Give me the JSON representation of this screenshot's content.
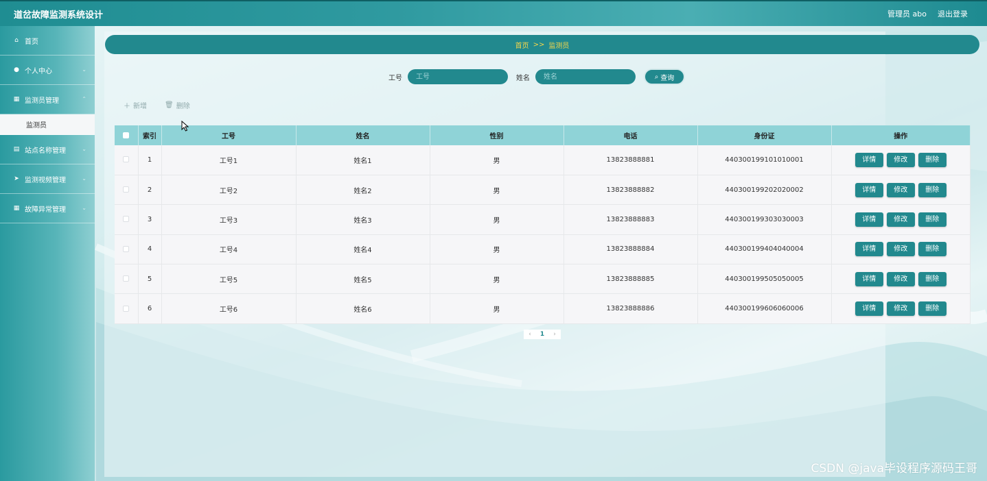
{
  "app": {
    "title": "道岔故障监测系统设计",
    "user_label": "管理员 abo",
    "logout_label": "退出登录"
  },
  "sidebar": {
    "items": [
      {
        "label": "首页",
        "icon": "home-icon"
      },
      {
        "label": "个人中心",
        "icon": "user-icon"
      },
      {
        "label": "监测员管理",
        "icon": "grid-icon"
      },
      {
        "label": "站点名称管理",
        "icon": "clipboard-icon"
      },
      {
        "label": "监测视频管理",
        "icon": "send-icon"
      },
      {
        "label": "故障异常管理",
        "icon": "grid-icon"
      }
    ],
    "active_sub": "监测员"
  },
  "breadcrumb": {
    "home": "首页",
    "sep": ">>",
    "current": "监测员"
  },
  "search": {
    "job_label": "工号",
    "job_placeholder": "工号",
    "name_label": "姓名",
    "name_placeholder": "姓名",
    "button_label": "查询"
  },
  "actions": {
    "add_label": "新增",
    "delete_label": "删除"
  },
  "table": {
    "headers": [
      "索引",
      "工号",
      "姓名",
      "性别",
      "电话",
      "身份证",
      "操作"
    ],
    "rows": [
      {
        "index": "1",
        "job": "工号1",
        "name": "姓名1",
        "gender": "男",
        "phone": "13823888881",
        "id_card": "440300199101010001"
      },
      {
        "index": "2",
        "job": "工号2",
        "name": "姓名2",
        "gender": "男",
        "phone": "13823888882",
        "id_card": "440300199202020002"
      },
      {
        "index": "3",
        "job": "工号3",
        "name": "姓名3",
        "gender": "男",
        "phone": "13823888883",
        "id_card": "440300199303030003"
      },
      {
        "index": "4",
        "job": "工号4",
        "name": "姓名4",
        "gender": "男",
        "phone": "13823888884",
        "id_card": "440300199404040004"
      },
      {
        "index": "5",
        "job": "工号5",
        "name": "姓名5",
        "gender": "男",
        "phone": "13823888885",
        "id_card": "440300199505050005"
      },
      {
        "index": "6",
        "job": "工号6",
        "name": "姓名6",
        "gender": "男",
        "phone": "13823888886",
        "id_card": "440300199606060006"
      }
    ],
    "row_buttons": {
      "detail": "详情",
      "edit": "修改",
      "delete": "删除"
    }
  },
  "pagination": {
    "prev": "‹",
    "current": "1",
    "next": "›"
  },
  "watermark": "CSDN @java毕设程序源码王哥",
  "colors": {
    "primary": "#22898e",
    "header": "#8fd3d7",
    "breadcrumb_text": "#f7d74a"
  }
}
